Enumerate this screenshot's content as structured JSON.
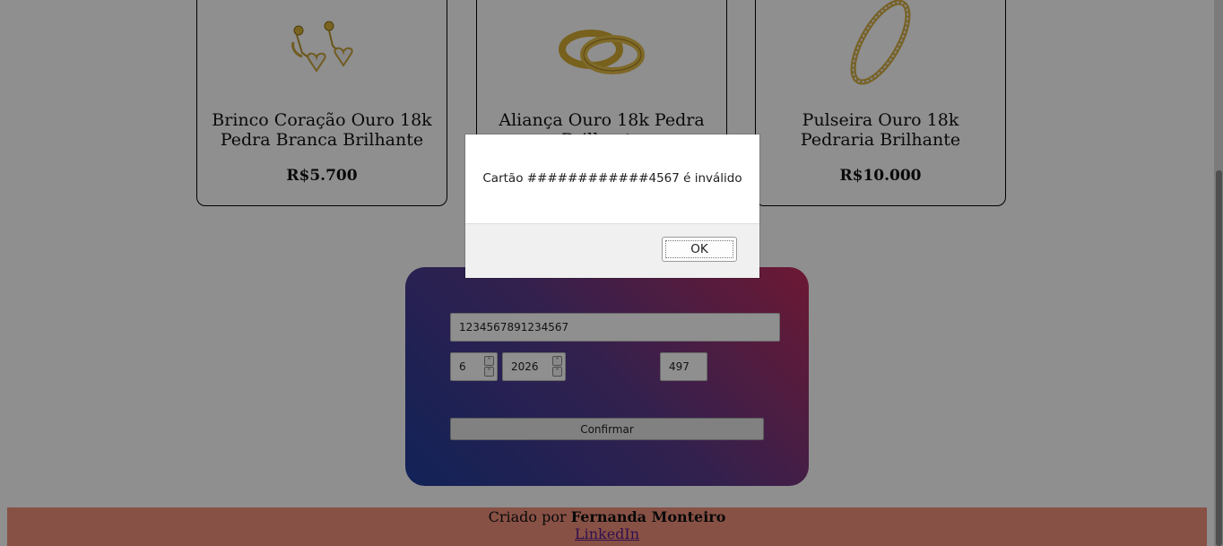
{
  "products": [
    {
      "name": "Brinco Coração Ouro 18k Pedra Branca Brilhante",
      "price": "R$5.700",
      "icon": "earring-image"
    },
    {
      "name": "Aliança Ouro 18k Pedra Brilhante",
      "price": "",
      "icon": "wedding-rings-image"
    },
    {
      "name": "Pulseira Ouro 18k Pedraria Brilhante",
      "price": "R$10.000",
      "icon": "bracelet-image"
    }
  ],
  "payment": {
    "card_number": "1234567891234567",
    "month": "6",
    "year": "2026",
    "cvv": "497",
    "confirm_label": "Confirmar"
  },
  "footer": {
    "created_by": "Criado por",
    "author": "Fernanda Monteiro",
    "link_label": "LinkedIn"
  },
  "dialog": {
    "message": "Cartão ############4567 é inválido",
    "ok_label": "OK"
  },
  "colors": {
    "gold": "#d9b33a",
    "footer_bg": "#f2917b",
    "gradient_start": "#1f3d9c",
    "gradient_end": "#c22c5c"
  }
}
